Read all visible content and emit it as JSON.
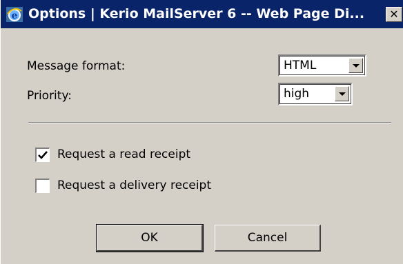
{
  "window": {
    "title": "Options | Kerio MailServer 6 -- Web Page Di...",
    "close_glyph": "✕",
    "title_icon": "internet-explorer-icon",
    "titlebar_color": "#0a246a"
  },
  "form": {
    "message_format": {
      "label": "Message format:",
      "value": "HTML"
    },
    "priority": {
      "label": "Priority:",
      "value": "high"
    },
    "read_receipt": {
      "label": "Request a read receipt",
      "checked": true
    },
    "delivery_receipt": {
      "label": "Request a delivery receipt",
      "checked": false
    }
  },
  "buttons": {
    "ok_label": "OK",
    "cancel_label": "Cancel"
  }
}
